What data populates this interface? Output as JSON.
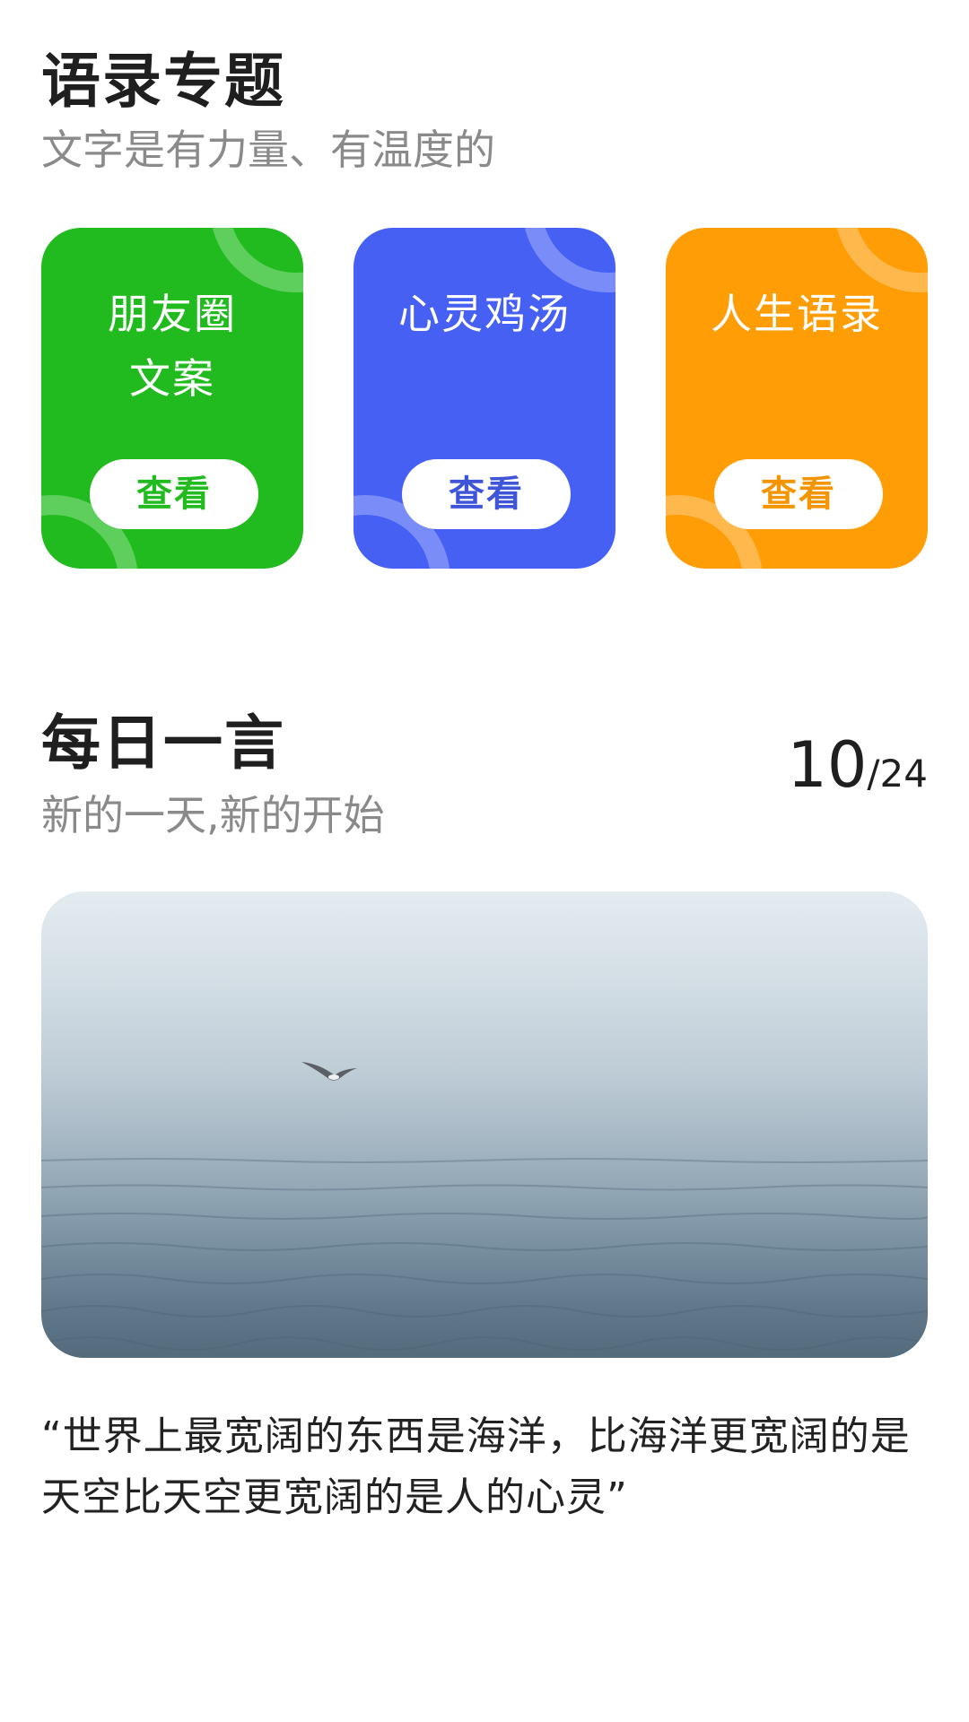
{
  "topics": {
    "title": "语录专题",
    "subtitle": "文字是有力量、有温度的",
    "cards": [
      {
        "title_lines": [
          "朋友圈",
          "文案"
        ],
        "button": "查看",
        "color": "#21bb1f"
      },
      {
        "title_lines": [
          "心灵鸡汤"
        ],
        "button": "查看",
        "color": "#4660f4"
      },
      {
        "title_lines": [
          "人生语录"
        ],
        "button": "查看",
        "color": "#ff9d06"
      }
    ]
  },
  "daily": {
    "title": "每日一言",
    "subtitle": "新的一天,新的开始",
    "counter": {
      "current": "10",
      "separator": "/",
      "total": "24"
    },
    "quote": "“世界上最宽阔的东西是海洋，比海洋更宽阔的是天空比天空更宽阔的是人的心灵”"
  }
}
